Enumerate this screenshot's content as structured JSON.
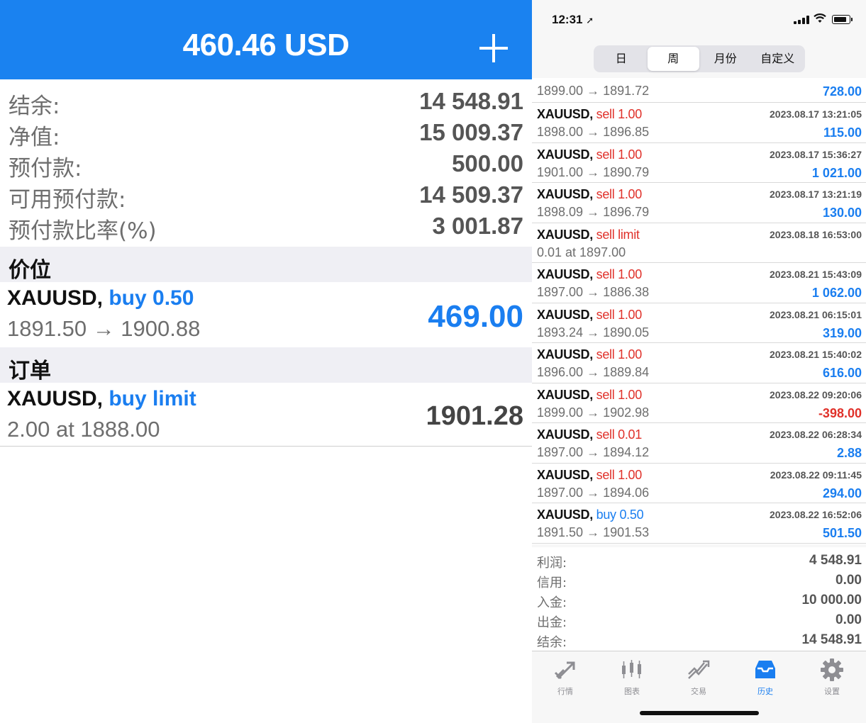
{
  "left": {
    "header_title": "460.46 USD",
    "summary": [
      {
        "label": "结余:",
        "value": "14 548.91"
      },
      {
        "label": "净值:",
        "value": "15 009.37"
      },
      {
        "label": "预付款:",
        "value": "500.00"
      },
      {
        "label": "可用预付款:",
        "value": "14 509.37"
      },
      {
        "label": "预付款比率(%)",
        "value": "3 001.87"
      }
    ],
    "positions_header": "价位",
    "position": {
      "symbol": "XAUUSD,",
      "action": "buy 0.50",
      "prices": "1891.50 → 1900.88",
      "profit": "469.00"
    },
    "orders_header": "订单",
    "order": {
      "symbol": "XAUUSD,",
      "action": "buy limit",
      "detail": "2.00 at 1888.00",
      "price": "1901.28"
    }
  },
  "right": {
    "status_time": "12:31",
    "segments": [
      "日",
      "周",
      "月份",
      "自定义"
    ],
    "active_segment": "周",
    "partial_deal": {
      "prices": "1899.00 → 1891.72",
      "profit": "728.00"
    },
    "deals": [
      {
        "symbol": "XAUUSD,",
        "side": "sell",
        "volume": "1.00",
        "datetime": "2023.08.17 13:21:05",
        "prices": "1898.00 → 1896.85",
        "profit": "115.00",
        "sign": "pos"
      },
      {
        "symbol": "XAUUSD,",
        "side": "sell",
        "volume": "1.00",
        "datetime": "2023.08.17 15:36:27",
        "prices": "1901.00 → 1890.79",
        "profit": "1 021.00",
        "sign": "pos"
      },
      {
        "symbol": "XAUUSD,",
        "side": "sell",
        "volume": "1.00",
        "datetime": "2023.08.17 13:21:19",
        "prices": "1898.09 → 1896.79",
        "profit": "130.00",
        "sign": "pos"
      },
      {
        "symbol": "XAUUSD,",
        "side": "sell limit",
        "volume": "",
        "datetime": "2023.08.18 16:53:00",
        "prices": "0.01 at 1897.00",
        "profit": "",
        "sign": "pos"
      },
      {
        "symbol": "XAUUSD,",
        "side": "sell",
        "volume": "1.00",
        "datetime": "2023.08.21 15:43:09",
        "prices": "1897.00 → 1886.38",
        "profit": "1 062.00",
        "sign": "pos"
      },
      {
        "symbol": "XAUUSD,",
        "side": "sell",
        "volume": "1.00",
        "datetime": "2023.08.21 06:15:01",
        "prices": "1893.24 → 1890.05",
        "profit": "319.00",
        "sign": "pos"
      },
      {
        "symbol": "XAUUSD,",
        "side": "sell",
        "volume": "1.00",
        "datetime": "2023.08.21 15:40:02",
        "prices": "1896.00 → 1889.84",
        "profit": "616.00",
        "sign": "pos"
      },
      {
        "symbol": "XAUUSD,",
        "side": "sell",
        "volume": "1.00",
        "datetime": "2023.08.22 09:20:06",
        "prices": "1899.00 → 1902.98",
        "profit": "-398.00",
        "sign": "neg"
      },
      {
        "symbol": "XAUUSD,",
        "side": "sell",
        "volume": "0.01",
        "datetime": "2023.08.22 06:28:34",
        "prices": "1897.00 → 1894.12",
        "profit": "2.88",
        "sign": "pos"
      },
      {
        "symbol": "XAUUSD,",
        "side": "sell",
        "volume": "1.00",
        "datetime": "2023.08.22 09:11:45",
        "prices": "1897.00 → 1894.06",
        "profit": "294.00",
        "sign": "pos"
      },
      {
        "symbol": "XAUUSD,",
        "side": "buy",
        "volume": "0.50",
        "datetime": "2023.08.22 16:52:06",
        "prices": "1891.50 → 1901.53",
        "profit": "501.50",
        "sign": "pos"
      }
    ],
    "totals": [
      {
        "label": "利润:",
        "value": "4 548.91"
      },
      {
        "label": "信用:",
        "value": "0.00"
      },
      {
        "label": "入金:",
        "value": "10 000.00"
      },
      {
        "label": "出金:",
        "value": "0.00"
      },
      {
        "label": "结余:",
        "value": "14 548.91"
      }
    ],
    "tabs": [
      {
        "label": "行情",
        "icon": "quotes-icon"
      },
      {
        "label": "图表",
        "icon": "chart-icon"
      },
      {
        "label": "交易",
        "icon": "trade-icon"
      },
      {
        "label": "历史",
        "icon": "history-icon"
      },
      {
        "label": "设置",
        "icon": "settings-icon"
      }
    ],
    "active_tab": "历史"
  },
  "colors": {
    "accent_blue": "#1a82f0",
    "sell_red": "#e0312a",
    "buy_blue": "#1a7ef0"
  }
}
